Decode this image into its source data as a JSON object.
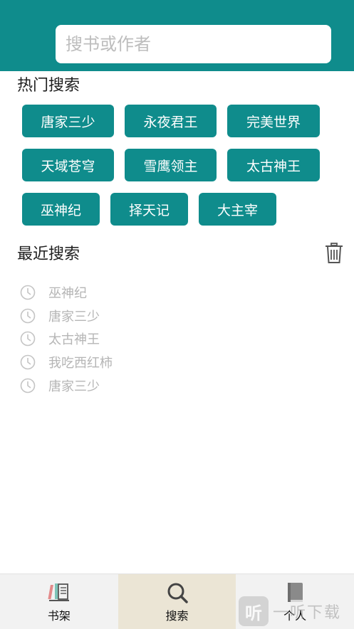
{
  "search": {
    "placeholder": "搜书或作者"
  },
  "hot": {
    "title": "热门搜索",
    "tags": [
      "唐家三少",
      "永夜君王",
      "完美世界",
      "天域苍穹",
      "雪鹰领主",
      "太古神王",
      "巫神纪",
      "择天记",
      "大主宰"
    ]
  },
  "recent": {
    "title": "最近搜索",
    "items": [
      "巫神纪",
      "唐家三少",
      "太古神王",
      "我吃西红柿",
      "唐家三少"
    ]
  },
  "tabs": [
    {
      "label": "书架",
      "icon": "bookshelf-icon"
    },
    {
      "label": "搜索",
      "icon": "search-icon",
      "active": true
    },
    {
      "label": "个人",
      "icon": "book-icon"
    }
  ],
  "watermark": {
    "logo": "听",
    "text": "一听下载"
  },
  "colors": {
    "accent": "#0f8c8c",
    "active_tab": "#ebe5d5"
  }
}
